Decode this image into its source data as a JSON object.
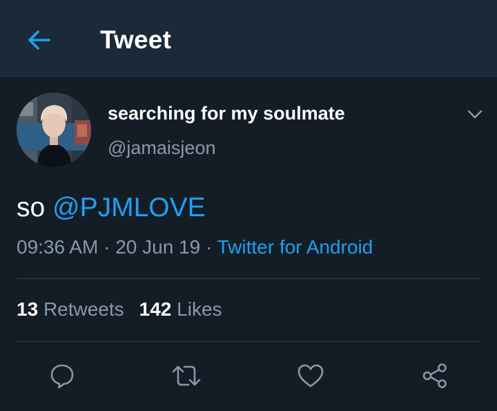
{
  "header": {
    "title": "Tweet",
    "back_icon": "arrow-left-icon"
  },
  "tweet": {
    "author": {
      "display_name": "searching for my soulmate",
      "handle": "@jamaisjeon"
    },
    "text_prefix": "so ",
    "mention": "@PJMLOVE",
    "time": "09:36 AM",
    "date": "20 Jun 19",
    "separator": " · ",
    "source": "Twitter for Android",
    "stats": {
      "retweets_count": "13",
      "retweets_label": "Retweets",
      "likes_count": "142",
      "likes_label": "Likes"
    },
    "actions": [
      "reply-icon",
      "retweet-icon",
      "like-icon",
      "share-icon"
    ]
  },
  "colors": {
    "background": "#141d26",
    "header_background": "#1c2938",
    "accent": "#1da1f2",
    "secondary_text": "#8899a6",
    "divider": "#2f3b48"
  }
}
